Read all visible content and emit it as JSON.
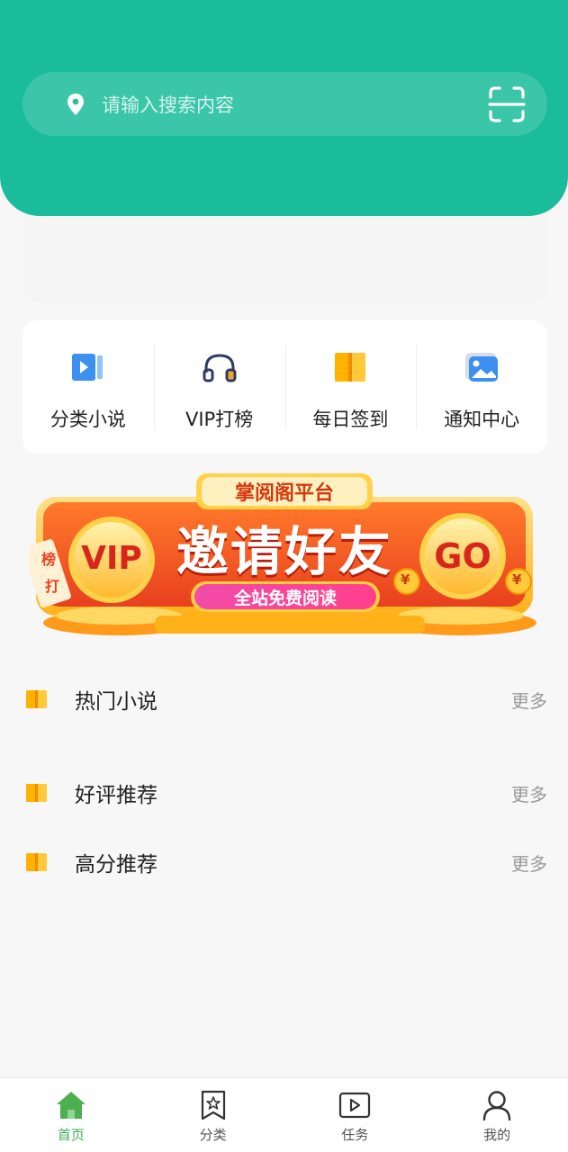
{
  "colors": {
    "brand": "#1bbc9b",
    "tab_active": "#3dae5a",
    "banner_red": "#e8401f",
    "banner_gold": "#ffb11a"
  },
  "search": {
    "placeholder": "请输入搜索内容",
    "left_icon": "location-pin-icon",
    "right_icon": "scan-icon"
  },
  "quick_menu": [
    {
      "label": "分类小说",
      "icon": "video-book-icon"
    },
    {
      "label": "VIP打榜",
      "icon": "headphones-icon"
    },
    {
      "label": "每日签到",
      "icon": "book-icon"
    },
    {
      "label": "通知中心",
      "icon": "image-icon"
    }
  ],
  "banner": {
    "platform": "掌阅阁平台",
    "headline": "邀请好友",
    "subline": "全站免费阅读",
    "left_badge": "VIP",
    "right_badge": "GO",
    "ribbon_top": "榜",
    "ribbon_bottom": "打",
    "coin_left": "¥",
    "coin_right": "¥"
  },
  "sections": [
    {
      "title": "热门小说",
      "more": "更多"
    },
    {
      "title": "好评推荐",
      "more": "更多"
    },
    {
      "title": "高分推荐",
      "more": "更多"
    }
  ],
  "tabbar": [
    {
      "label": "首页",
      "icon": "home-icon",
      "active": true
    },
    {
      "label": "分类",
      "icon": "bookmark-star-icon",
      "active": false
    },
    {
      "label": "任务",
      "icon": "play-icon",
      "active": false
    },
    {
      "label": "我的",
      "icon": "user-icon",
      "active": false
    }
  ]
}
